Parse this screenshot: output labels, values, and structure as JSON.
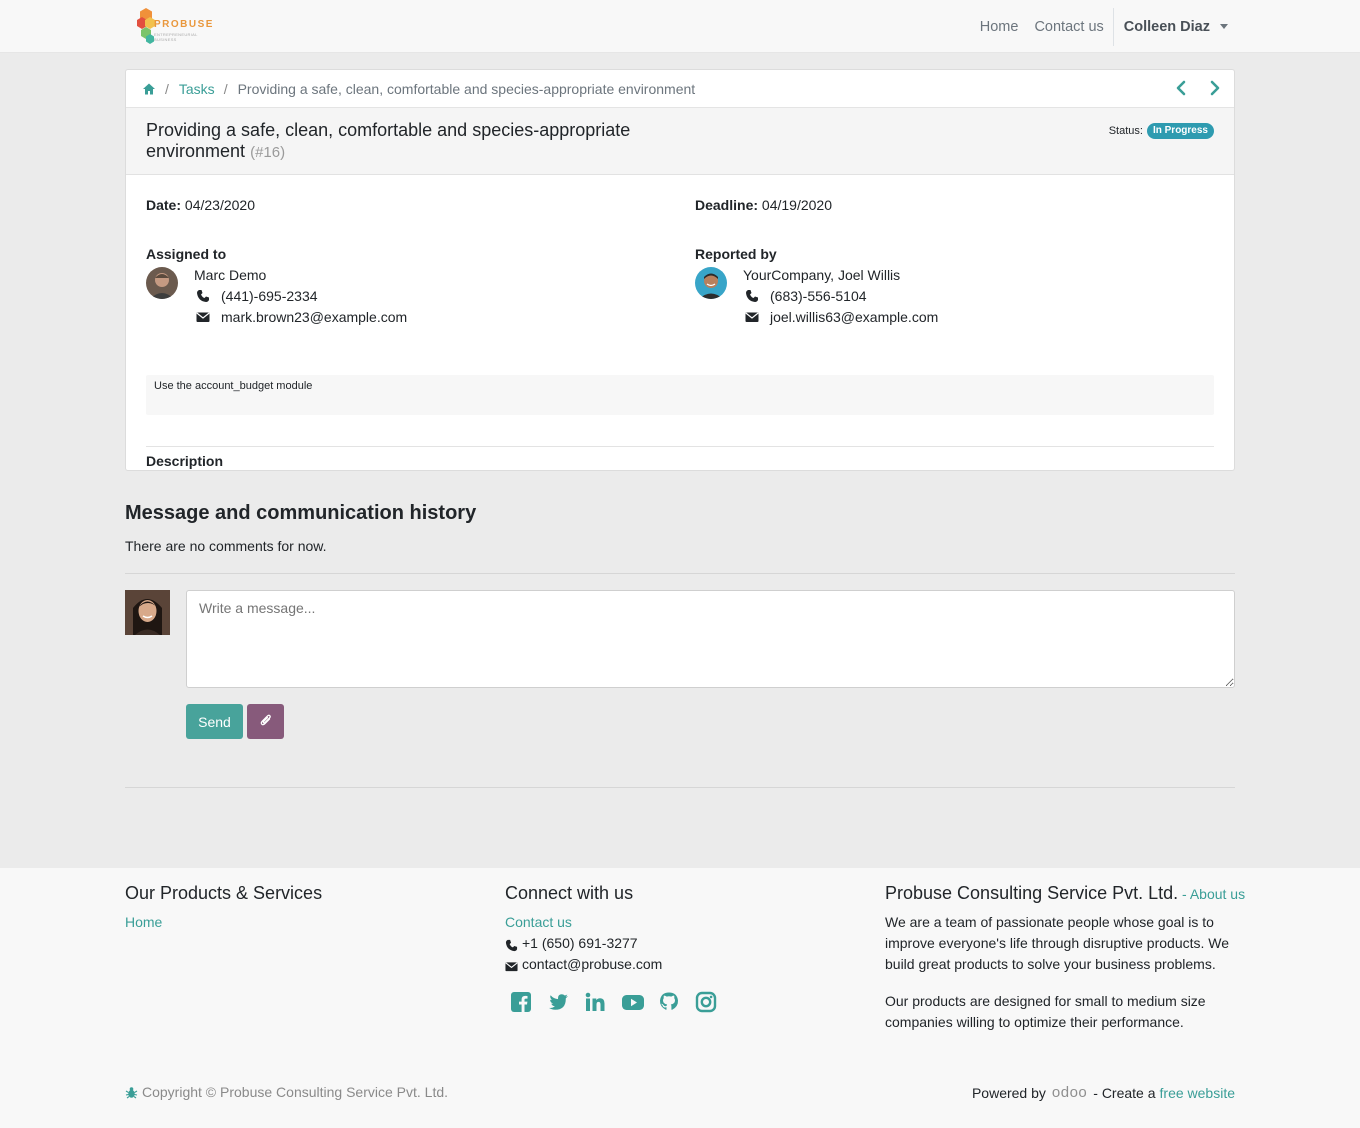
{
  "brand": {
    "name": "PROBUSE",
    "tagline": "ENTREPRENEURIAL BUSINESS"
  },
  "nav": {
    "home": "Home",
    "contact": "Contact us",
    "user": "Colleen Diaz"
  },
  "breadcrumb": {
    "tasks": "Tasks",
    "current": "Providing a safe, clean, comfortable and species-appropriate environment"
  },
  "task": {
    "title": "Providing a safe, clean, comfortable and species-appropriate environment",
    "id": "(#16)",
    "status_label": "Status:",
    "status": "In Progress",
    "date_label": "Date:",
    "date": "04/23/2020",
    "deadline_label": "Deadline:",
    "deadline": "04/19/2020",
    "assigned_label": "Assigned to",
    "assigned": {
      "name": "Marc Demo",
      "phone": "(441)-695-2334",
      "email": "mark.brown23@example.com"
    },
    "reported_label": "Reported by",
    "reported": {
      "name": "YourCompany, Joel Willis",
      "phone": "(683)-556-5104",
      "email": "joel.willis63@example.com"
    },
    "description_label": "Description",
    "description": "Use the account_budget module"
  },
  "messages": {
    "title": "Message and communication history",
    "empty": "There are no comments for now.",
    "placeholder": "Write a message...",
    "send": "Send"
  },
  "footer": {
    "products_title": "Our Products & Services",
    "products_home": "Home",
    "connect_title": "Connect with us",
    "connect_contact": "Contact us",
    "phone": "+1 (650) 691-3277",
    "email": "contact@probuse.com",
    "social_icons": [
      "facebook-icon",
      "twitter-icon",
      "linkedin-icon",
      "youtube-icon",
      "github-icon",
      "instagram-icon"
    ],
    "company_title": "Probuse Consulting Service Pvt. Ltd.",
    "company_sep": " - ",
    "about": "About us",
    "about_p1": "We are a team of passionate people whose goal is to improve everyone's life through disruptive products. We build great products to solve your business problems.",
    "about_p2": "Our products are designed for small to medium size companies willing to optimize their performance.",
    "copyright": "Copyright © Probuse Consulting Service Pvt. Ltd.",
    "powered_by": "Powered by",
    "odoo": "odoo",
    "create": "- Create a",
    "free_website": "free website"
  },
  "colors": {
    "accent": "#3a9e97",
    "send_button": "#48a39b",
    "attach_button": "#875a7b",
    "status_badge": "#2e9bb0"
  }
}
